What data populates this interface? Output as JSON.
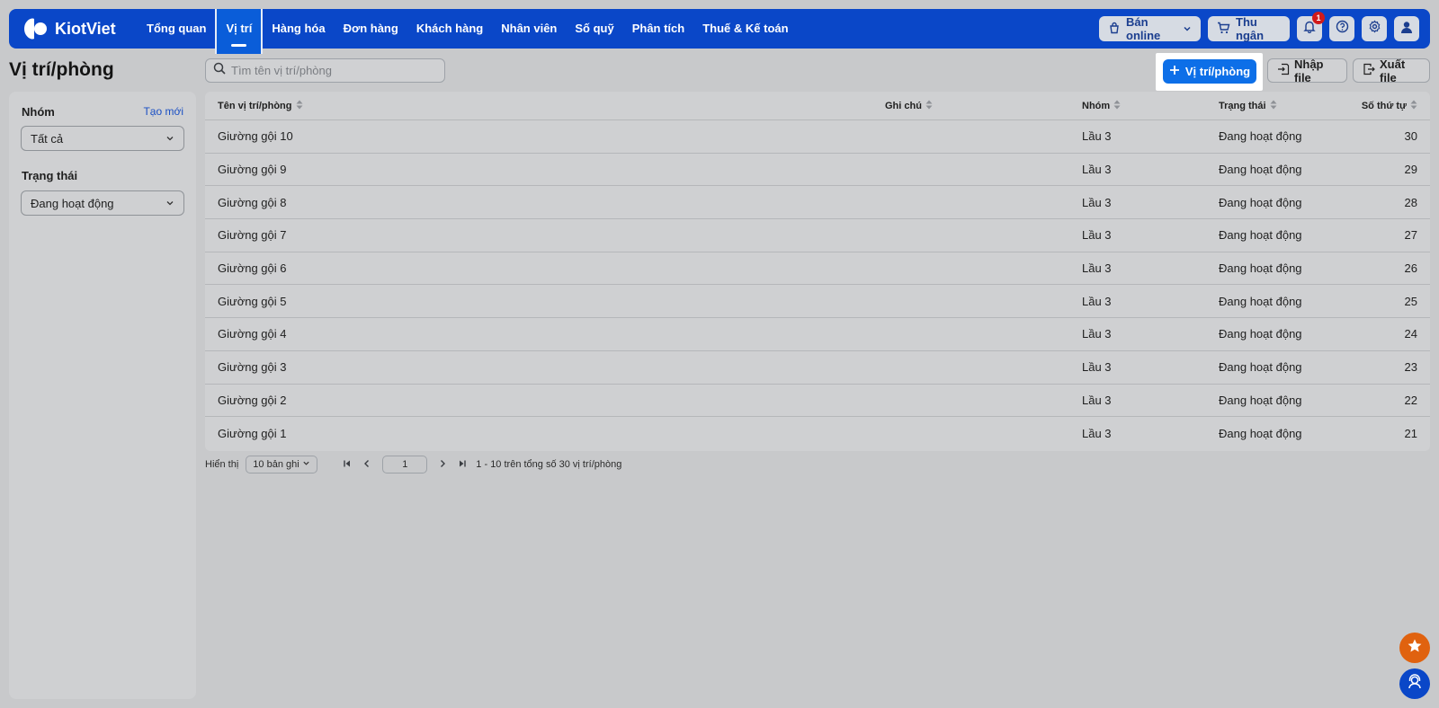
{
  "colors": {
    "nav_bg": "#0a47c8",
    "primary": "#0d6fe8",
    "link": "#1a4fc4",
    "badge": "#d11b1b",
    "fab_orange": "#e0620f",
    "fab_blue": "#0a47c8"
  },
  "brand": {
    "name": "KiotViet"
  },
  "nav": {
    "items": [
      "Tổng quan",
      "Vị trí",
      "Hàng hóa",
      "Đơn hàng",
      "Khách hàng",
      "Nhân viên",
      "Số quỹ",
      "Phân tích",
      "Thuế & Kế toán"
    ],
    "active": "Vị trí",
    "ban_online": "Bán online",
    "thu_ngan": "Thu ngân",
    "notification_count": "1"
  },
  "page": {
    "title": "Vị trí/phòng"
  },
  "search": {
    "placeholder": "Tìm tên vị trí/phòng"
  },
  "toolbar": {
    "add_label": "Vị trí/phòng",
    "import_label": "Nhập file",
    "export_label": "Xuất file"
  },
  "sidebar": {
    "group_label": "Nhóm",
    "create_link": "Tạo mới",
    "group_value": "Tất cả",
    "status_label": "Trạng thái",
    "status_value": "Đang hoạt động"
  },
  "table": {
    "headers": {
      "name": "Tên vị trí/phòng",
      "note": "Ghi chú",
      "group": "Nhóm",
      "status": "Trạng thái",
      "order": "Số thứ tự"
    },
    "rows": [
      {
        "name": "Giường gội 10",
        "note": "",
        "group": "Lầu 3",
        "status": "Đang hoạt động",
        "order": "30"
      },
      {
        "name": "Giường gội 9",
        "note": "",
        "group": "Lầu 3",
        "status": "Đang hoạt động",
        "order": "29"
      },
      {
        "name": "Giường gội 8",
        "note": "",
        "group": "Lầu 3",
        "status": "Đang hoạt động",
        "order": "28"
      },
      {
        "name": "Giường gội 7",
        "note": "",
        "group": "Lầu 3",
        "status": "Đang hoạt động",
        "order": "27"
      },
      {
        "name": "Giường gội 6",
        "note": "",
        "group": "Lầu 3",
        "status": "Đang hoạt động",
        "order": "26"
      },
      {
        "name": "Giường gội 5",
        "note": "",
        "group": "Lầu 3",
        "status": "Đang hoạt động",
        "order": "25"
      },
      {
        "name": "Giường gội 4",
        "note": "",
        "group": "Lầu 3",
        "status": "Đang hoạt động",
        "order": "24"
      },
      {
        "name": "Giường gội 3",
        "note": "",
        "group": "Lầu 3",
        "status": "Đang hoạt động",
        "order": "23"
      },
      {
        "name": "Giường gội 2",
        "note": "",
        "group": "Lầu 3",
        "status": "Đang hoạt động",
        "order": "22"
      },
      {
        "name": "Giường gội 1",
        "note": "",
        "group": "Lầu 3",
        "status": "Đang hoạt động",
        "order": "21"
      }
    ]
  },
  "pagination": {
    "show_label": "Hiển thị",
    "page_size": "10 bản ghi",
    "current_page": "1",
    "summary": "1 - 10 trên tổng số 30 vị trí/phòng"
  },
  "floating": {
    "star_icon": "star-icon",
    "support_icon": "support-agent-icon"
  }
}
